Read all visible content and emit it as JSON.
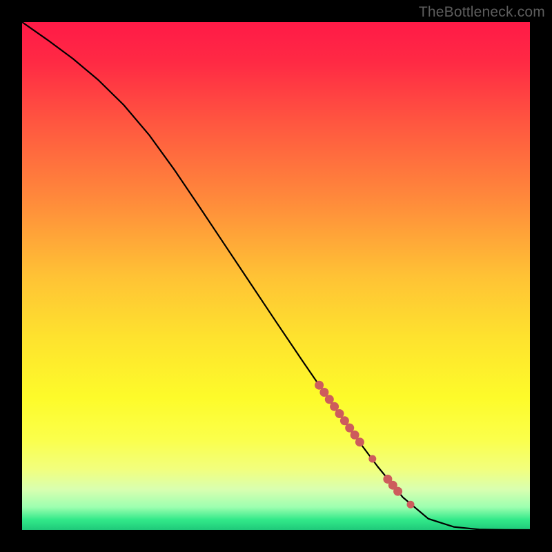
{
  "watermark": "TheBottleneck.com",
  "colors": {
    "gradient_stops": [
      {
        "offset": 0.0,
        "color": "#ff1a47"
      },
      {
        "offset": 0.08,
        "color": "#ff2a44"
      },
      {
        "offset": 0.2,
        "color": "#ff5740"
      },
      {
        "offset": 0.35,
        "color": "#ff8a3b"
      },
      {
        "offset": 0.5,
        "color": "#ffc235"
      },
      {
        "offset": 0.62,
        "color": "#fee22e"
      },
      {
        "offset": 0.74,
        "color": "#fdfb2a"
      },
      {
        "offset": 0.82,
        "color": "#fbff4a"
      },
      {
        "offset": 0.88,
        "color": "#f2ff7d"
      },
      {
        "offset": 0.92,
        "color": "#d9ffb0"
      },
      {
        "offset": 0.955,
        "color": "#9dffb0"
      },
      {
        "offset": 0.98,
        "color": "#32e989"
      },
      {
        "offset": 1.0,
        "color": "#1fc97a"
      }
    ],
    "line": "#000000",
    "marker_fill": "#cd5c5c",
    "marker_stroke": "#cd5c5c"
  },
  "chart_data": {
    "type": "line",
    "title": "",
    "xlabel": "",
    "ylabel": "",
    "xlim": [
      0,
      100
    ],
    "ylim": [
      0,
      100
    ],
    "grid": false,
    "series": [
      {
        "name": "curve",
        "x": [
          0,
          5,
          10,
          15,
          20,
          25,
          30,
          35,
          40,
          45,
          50,
          55,
          60,
          65,
          70,
          75,
          80,
          85,
          90,
          92,
          95,
          100
        ],
        "y": [
          100,
          96.5,
          92.8,
          88.6,
          83.7,
          77.8,
          70.9,
          63.5,
          56.0,
          48.5,
          41.0,
          33.6,
          26.3,
          19.2,
          12.5,
          6.4,
          2.2,
          0.6,
          0.1,
          0.05,
          0.02,
          0.0
        ]
      }
    ],
    "markers": [
      {
        "x": 58.5,
        "y": 28.5,
        "r": 6
      },
      {
        "x": 59.5,
        "y": 27.1,
        "r": 6
      },
      {
        "x": 60.5,
        "y": 25.7,
        "r": 6
      },
      {
        "x": 61.5,
        "y": 24.3,
        "r": 6
      },
      {
        "x": 62.5,
        "y": 22.9,
        "r": 6
      },
      {
        "x": 63.5,
        "y": 21.5,
        "r": 6
      },
      {
        "x": 64.5,
        "y": 20.1,
        "r": 6
      },
      {
        "x": 65.5,
        "y": 18.7,
        "r": 6
      },
      {
        "x": 66.5,
        "y": 17.3,
        "r": 6
      },
      {
        "x": 69.0,
        "y": 14.0,
        "r": 5
      },
      {
        "x": 72.0,
        "y": 10.0,
        "r": 6
      },
      {
        "x": 73.0,
        "y": 8.8,
        "r": 6
      },
      {
        "x": 74.0,
        "y": 7.6,
        "r": 6
      },
      {
        "x": 76.5,
        "y": 5.0,
        "r": 5
      }
    ]
  }
}
